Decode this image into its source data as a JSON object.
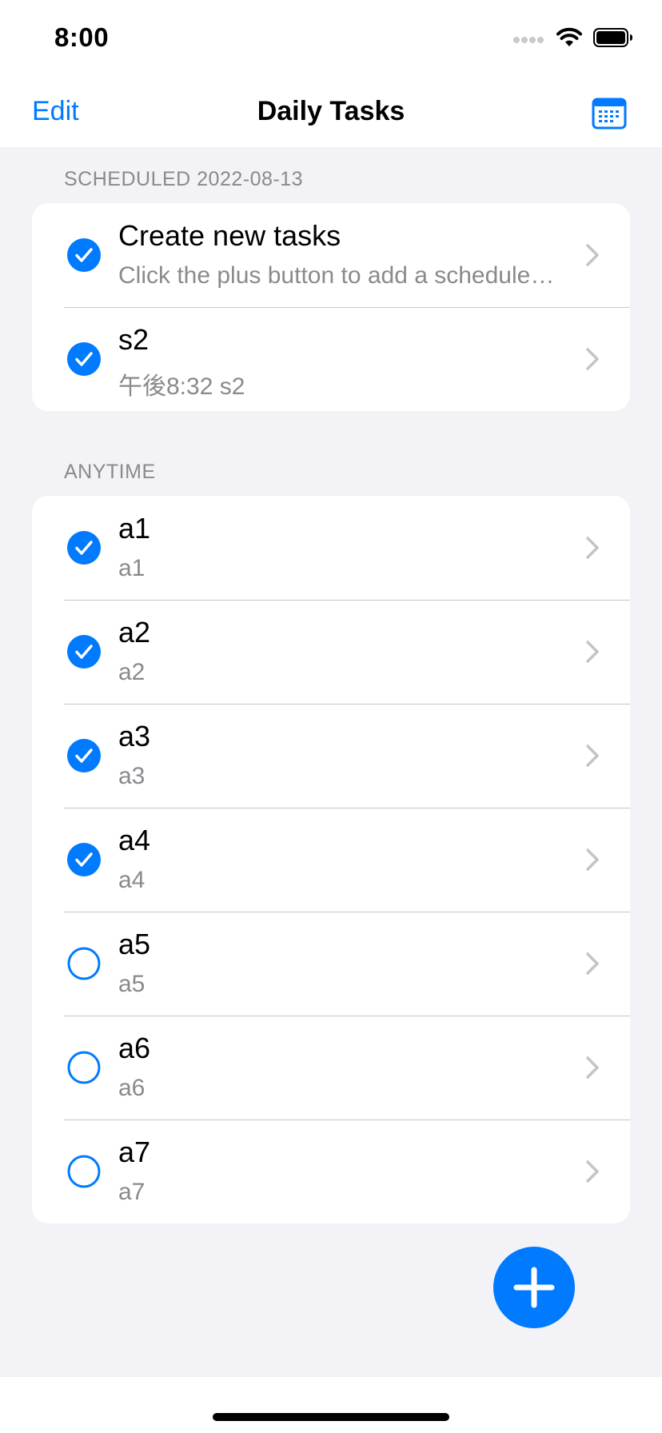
{
  "status": {
    "time": "8:00",
    "icons": [
      "cellular-icon",
      "wifi-icon",
      "battery-icon"
    ]
  },
  "nav": {
    "edit_label": "Edit",
    "title": "Daily Tasks",
    "calendar_icon": "calendar-icon"
  },
  "colors": {
    "accent": "#007aff",
    "background": "#f2f2f7",
    "secondary_text": "#8a8a8e"
  },
  "sections": [
    {
      "header": "SCHEDULED 2022-08-13",
      "items": [
        {
          "title": "Create new tasks",
          "subtitle": "Click the plus button to add a schedule…",
          "done": true
        },
        {
          "title": "s2",
          "subtitle": "午後8:32 s2",
          "done": true
        }
      ]
    },
    {
      "header": "ANYTIME",
      "items": [
        {
          "title": "a1",
          "subtitle": "a1",
          "done": true
        },
        {
          "title": "a2",
          "subtitle": "a2",
          "done": true
        },
        {
          "title": "a3",
          "subtitle": "a3",
          "done": true
        },
        {
          "title": "a4",
          "subtitle": "a4",
          "done": true
        },
        {
          "title": "a5",
          "subtitle": "a5",
          "done": false
        },
        {
          "title": "a6",
          "subtitle": "a6",
          "done": false
        },
        {
          "title": "a7",
          "subtitle": "a7",
          "done": false
        }
      ]
    }
  ],
  "fab": {
    "icon": "plus-icon"
  }
}
